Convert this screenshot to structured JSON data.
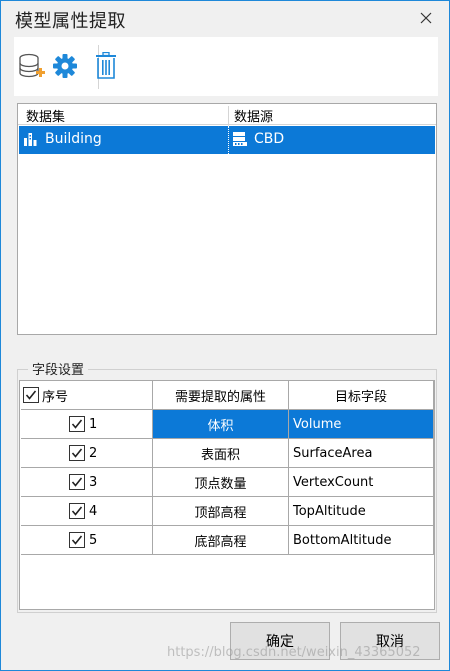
{
  "window": {
    "title": "模型属性提取"
  },
  "toolbar": {
    "add_dataset_icon": "database-add-icon",
    "settings_icon": "gear-icon",
    "delete_icon": "trash-icon"
  },
  "dataset_grid": {
    "headers": [
      "数据集",
      "数据源"
    ],
    "rows": [
      {
        "dataset": "Building",
        "datasource": "CBD"
      }
    ]
  },
  "fields": {
    "group_label": "字段设置",
    "headers": [
      "序号",
      "需要提取的属性",
      "目标字段"
    ],
    "rows": [
      {
        "index": "1",
        "attribute": "体积",
        "target": "Volume",
        "checked": true
      },
      {
        "index": "2",
        "attribute": "表面积",
        "target": "SurfaceArea",
        "checked": true
      },
      {
        "index": "3",
        "attribute": "顶点数量",
        "target": "VertexCount",
        "checked": true
      },
      {
        "index": "4",
        "attribute": "顶部高程",
        "target": "TopAltitude",
        "checked": true
      },
      {
        "index": "5",
        "attribute": "底部高程",
        "target": "BottomAltitude",
        "checked": true
      }
    ]
  },
  "buttons": {
    "ok": "确定",
    "cancel": "取消"
  },
  "watermark": "https://blog.csdn.net/weixin_43365052",
  "colors": {
    "selection": "#0c79d7",
    "icon_blue": "#1e88d9",
    "add_orange": "#f0a030"
  }
}
